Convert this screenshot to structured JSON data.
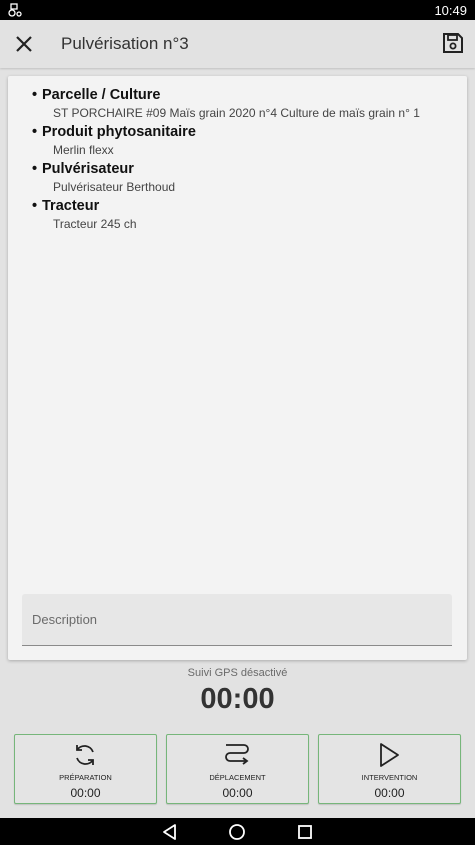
{
  "status_bar": {
    "time": "10:49",
    "app_icon": "tractor-icon"
  },
  "toolbar": {
    "title": "Pulvérisation n°3",
    "close_icon": "close-icon",
    "save_icon": "save-icon"
  },
  "details": [
    {
      "heading": "Parcelle / Culture",
      "value": "ST PORCHAIRE #09 Maïs grain 2020 n°4 Culture de maïs grain n° 1"
    },
    {
      "heading": "Produit phytosanitaire",
      "value": "Merlin flexx"
    },
    {
      "heading": "Pulvérisateur",
      "value": "Pulvérisateur Berthoud"
    },
    {
      "heading": "Tracteur",
      "value": "Tracteur 245 ch"
    }
  ],
  "description": {
    "placeholder": "Description"
  },
  "gps": {
    "status": "Suivi GPS désactivé",
    "timer": "00:00"
  },
  "actions": [
    {
      "label": "PRÉPARATION",
      "value": "00:00",
      "icon": "refresh-icon"
    },
    {
      "label": "DÉPLACEMENT",
      "value": "00:00",
      "icon": "route-icon"
    },
    {
      "label": "INTERVENTION",
      "value": "00:00",
      "icon": "play-icon"
    }
  ],
  "colors": {
    "accent_border": "#76b67a",
    "background": "#e2e2e2"
  }
}
